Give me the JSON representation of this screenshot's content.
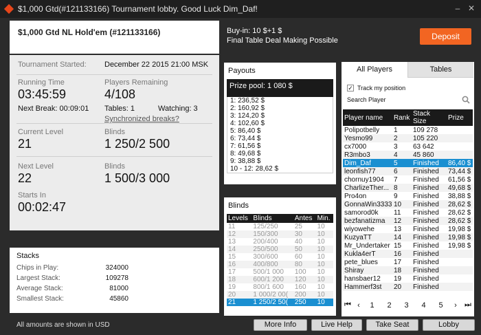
{
  "window": {
    "title": "$1,000 Gtd(#121133166) Tournament lobby. Good Luck Dim_Daf!"
  },
  "header": {
    "tournament_name": "$1,000 Gtd NL Hold'em (#121133166)",
    "buyin": "Buy-in: 10 $+1 $",
    "deal": "Final Table Deal Making Possible",
    "deposit_label": "Deposit",
    "accent_color": "#f26522"
  },
  "info": {
    "started_label": "Tournament Started:",
    "started_value": "December 22 2015   21:00 MSK",
    "running_label": "Running Time",
    "running_value": "03:45:59",
    "remaining_label": "Players Remaining",
    "remaining_value": "4/108",
    "next_break_label": "Next Break: 00:09:01",
    "tables_label": "Tables: 1",
    "watching_label": "Watching: 3",
    "sync_breaks": "Synchronized breaks?",
    "current_level_label": "Current Level",
    "current_level_value": "21",
    "current_blinds_label": "Blinds",
    "current_blinds_value": "1 250/2 500",
    "next_level_label": "Next Level",
    "next_level_value": "22",
    "next_blinds_label": "Blinds",
    "next_blinds_value": "1 500/3 000",
    "starts_in_label": "Starts In",
    "starts_in_value": "00:02:47"
  },
  "stacks": {
    "title": "Stacks",
    "rows": [
      {
        "label": "Chips in Play:",
        "value": "324000"
      },
      {
        "label": "Largest Stack:",
        "value": "109278"
      },
      {
        "label": "Average Stack:",
        "value": "81000"
      },
      {
        "label": "Smallest Stack:",
        "value": "45860"
      }
    ]
  },
  "payouts": {
    "title": "Payouts",
    "prize_pool": "Prize pool: 1 080 $",
    "items": [
      "1: 236,52 $",
      "2: 160,92 $",
      "3: 124,20 $",
      "4: 102,60 $",
      "5: 86,40 $",
      "6: 73,44 $",
      "7: 61,56 $",
      "8: 49,68 $",
      "9: 38,88 $",
      "10 - 12: 28,62 $"
    ]
  },
  "blinds": {
    "title": "Blinds",
    "headers": [
      "Levels",
      "Blinds",
      "Antes",
      "Min."
    ],
    "rows": [
      [
        "11",
        "125/250",
        "25",
        "10"
      ],
      [
        "12",
        "150/300",
        "30",
        "10"
      ],
      [
        "13",
        "200/400",
        "40",
        "10"
      ],
      [
        "14",
        "250/500",
        "50",
        "10"
      ],
      [
        "15",
        "300/600",
        "60",
        "10"
      ],
      [
        "16",
        "400/800",
        "80",
        "10"
      ],
      [
        "17",
        "500/1 000",
        "100",
        "10"
      ],
      [
        "18",
        "600/1 200",
        "120",
        "10"
      ],
      [
        "19",
        "800/1 600",
        "160",
        "10"
      ],
      [
        "20",
        "1 000/2 00(",
        "200",
        "10"
      ],
      [
        "21",
        "1 250/2 50(",
        "250",
        "10"
      ]
    ]
  },
  "players": {
    "tab_all": "All Players",
    "tab_tables": "Tables",
    "track_label": "Track my position",
    "search_label": "Search Player",
    "headers": [
      "Player name",
      "Rank",
      "Stack Size",
      "Prize"
    ],
    "rows": [
      [
        "Polipotbelly",
        "1",
        "109 278",
        ""
      ],
      [
        "Yesmo99",
        "2",
        "105 220",
        ""
      ],
      [
        "cx7000",
        "3",
        "63 642",
        ""
      ],
      [
        "R3mbo3",
        "4",
        "45 860",
        ""
      ],
      [
        "Dim_Daf",
        "5",
        "Finished",
        "86,40 $"
      ],
      [
        "leonfish77",
        "6",
        "Finished",
        "73,44 $"
      ],
      [
        "chornuy1904",
        "7",
        "Finished",
        "61,56 $"
      ],
      [
        "CharlizeTher...",
        "8",
        "Finished",
        "49,68 $"
      ],
      [
        "Pro4on",
        "9",
        "Finished",
        "38,88 $"
      ],
      [
        "GonnaWin3333",
        "10",
        "Finished",
        "28,62 $"
      ],
      [
        "samorod0k",
        "11",
        "Finished",
        "28,62 $"
      ],
      [
        "bezfanatizma",
        "12",
        "Finished",
        "28,62 $"
      ],
      [
        "wiyowehe",
        "13",
        "Finished",
        "19,98 $"
      ],
      [
        "KuzyaTT",
        "14",
        "Finished",
        "19,98 $"
      ],
      [
        "Mr_Undertaker",
        "15",
        "Finished",
        "19,98 $"
      ],
      [
        "Kukla4erT",
        "16",
        "Finished",
        ""
      ],
      [
        "pete_blues",
        "17",
        "Finished",
        ""
      ],
      [
        "Shiray",
        "18",
        "Finished",
        ""
      ],
      [
        "hansbaer12",
        "19",
        "Finished",
        ""
      ],
      [
        "Hammerf3st",
        "20",
        "Finished",
        ""
      ]
    ],
    "pages": [
      "1",
      "2",
      "3",
      "4",
      "5"
    ],
    "first": "⏮",
    "prev": "‹",
    "next": "›",
    "last": "⏭"
  },
  "footer": {
    "note": "All amounts are shown in USD",
    "more_info": "More Info",
    "live_help": "Live Help",
    "take_seat": "Take Seat",
    "lobby": "Lobby"
  }
}
